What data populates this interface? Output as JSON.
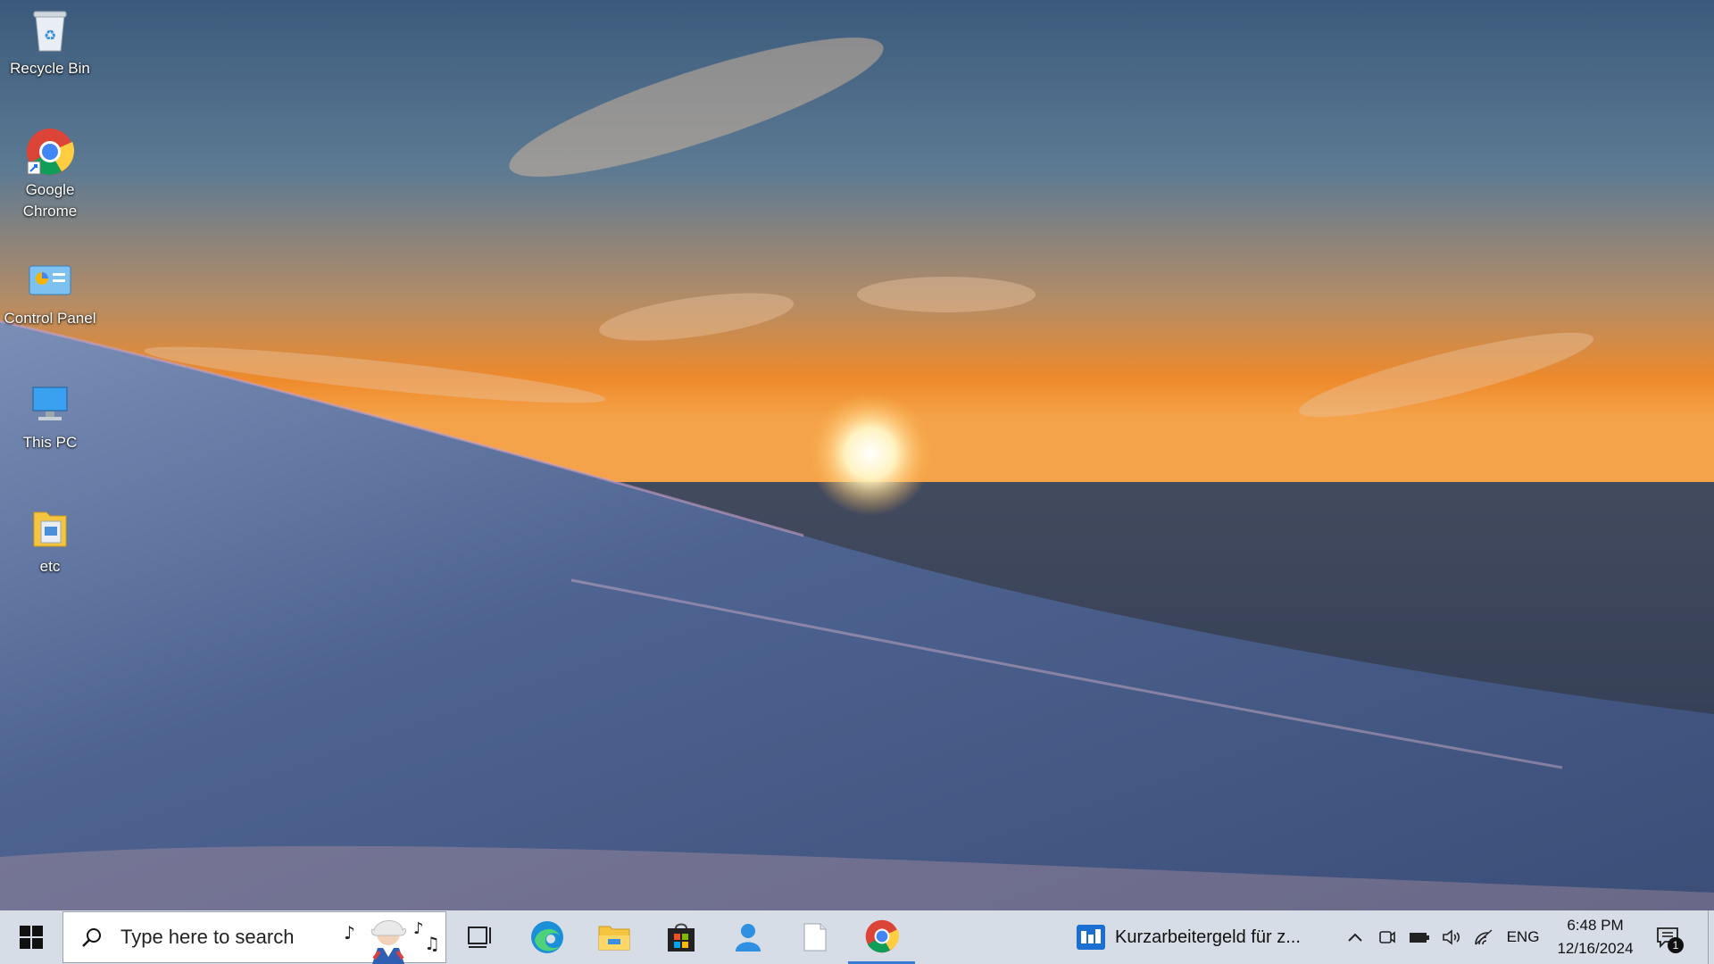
{
  "desktop": {
    "icons": [
      {
        "label": "Recycle Bin",
        "icon": "recycle-bin-icon"
      },
      {
        "label": "Google Chrome",
        "icon": "chrome-icon"
      },
      {
        "label": "Control Panel",
        "icon": "control-panel-icon"
      },
      {
        "label": "This PC",
        "icon": "monitor-icon"
      },
      {
        "label": "etc",
        "icon": "folder-icon"
      }
    ]
  },
  "taskbar": {
    "search": {
      "placeholder": "Type here to search"
    },
    "apps": [
      {
        "name": "Task View",
        "icon": "task-view-icon"
      },
      {
        "name": "Microsoft Edge",
        "icon": "edge-icon"
      },
      {
        "name": "File Explorer",
        "icon": "file-explorer-icon"
      },
      {
        "name": "Microsoft Store",
        "icon": "store-icon"
      },
      {
        "name": "People",
        "icon": "person-icon"
      },
      {
        "name": "Notepad",
        "icon": "document-icon"
      },
      {
        "name": "Google Chrome",
        "icon": "chrome-icon"
      }
    ],
    "news_widget": {
      "text": "Kurzarbeitergeld für z..."
    },
    "tray": {
      "language": "ENG",
      "time": "6:48 PM",
      "date": "12/16/2024",
      "notification_count": "1"
    }
  },
  "colors": {
    "taskbar": "#d7dde6",
    "accent": "#3a7bd5"
  }
}
